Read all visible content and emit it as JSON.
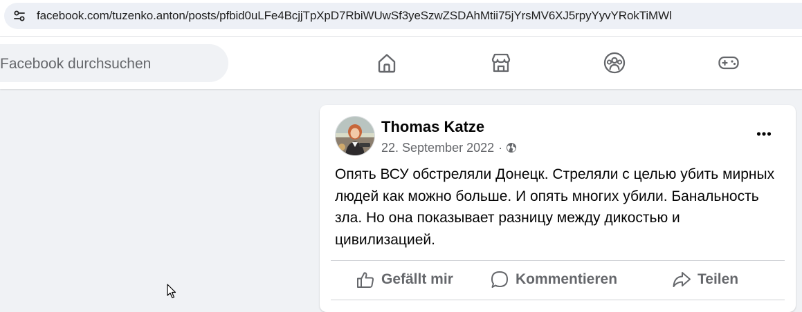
{
  "browser": {
    "url": "facebook.com/tuzenko.anton/posts/pfbid0uLFe4BcjjTpXpD7RbiWUwSf3yeSzwZSDAhMtii75jYrsMV6XJ5rpyYyvYRokTiMWl",
    "site_info_icon": "tune-icon"
  },
  "header": {
    "search_placeholder": "Facebook durchsuchen",
    "nav": [
      {
        "icon": "home-icon"
      },
      {
        "icon": "marketplace-icon"
      },
      {
        "icon": "groups-icon"
      },
      {
        "icon": "gaming-icon"
      }
    ]
  },
  "post": {
    "author": "Thomas Katze",
    "date": "22. September 2022",
    "separator": "·",
    "audience_icon": "globe-icon",
    "more_icon": "more-horizontal-icon",
    "text": "Опять ВСУ обстреляли Донецк. Стреляли с целью убить мирных людей как можно больше. И опять многих убили. Банальность зла. Но она показывает разницу между дикостью и цивилизацией.",
    "actions": {
      "like": "Gefällt mir",
      "comment": "Kommentieren",
      "share": "Teilen"
    }
  },
  "colors": {
    "page_background": "#f0f2f5",
    "secondary_text": "#65676b",
    "primary_text": "#050505",
    "url_field": "#edf0f6"
  }
}
